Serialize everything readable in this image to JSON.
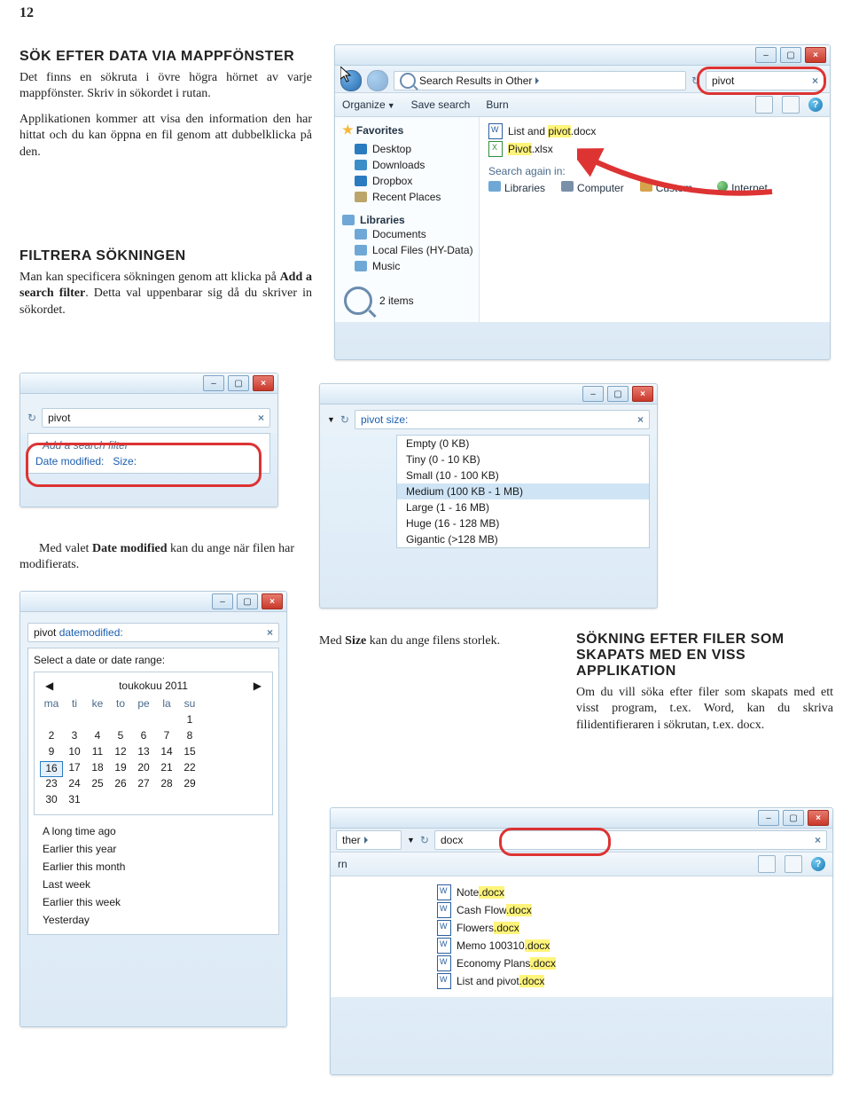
{
  "page_number": "12",
  "sec1": {
    "title": "SÖK EFTER DATA VIA MAPPFÖNSTER",
    "p1": "Det finns en sökruta i övre högra hörnet av varje mappfönster. Skriv in sökordet i rutan.",
    "p2": "Applikationen kommer att visa den information den har hittat och du kan öppna en fil genom att dubbelklicka på den."
  },
  "sec2": {
    "title": "FILTRERA SÖKNINGEN",
    "p1a": "Man kan specificera sökningen genom att klicka på ",
    "p1b": "Add a search filter",
    "p1c": ". Detta val uppenbarar sig då du skriver in sökordet."
  },
  "cap_date_a": "Med valet ",
  "cap_date_b": "Date modified",
  "cap_date_c": " kan du ange när filen har modifierats.",
  "cap_size_a": "Med ",
  "cap_size_b": "Size",
  "cap_size_c": " kan du ange filens storlek.",
  "sec3": {
    "title": "SÖKNING EFTER FILER SOM SKAPATS MED EN VISS APPLIKATION",
    "p1": "Om du vill söka efter filer som skapats med ett visst program, t.ex. Word, kan du skriva filidentifieraren i sökrutan, t.ex. docx."
  },
  "shot1": {
    "crumb": "Search Results in Other",
    "search_value": "pivot",
    "toolbar": {
      "organize": "Organize",
      "save": "Save search",
      "burn": "Burn"
    },
    "fav_header": "Favorites",
    "fav": [
      "Desktop",
      "Downloads",
      "Dropbox",
      "Recent Places"
    ],
    "lib_header": "Libraries",
    "libs": [
      "Documents",
      "Local Files (HY-Data)",
      "Music"
    ],
    "items_count": "2 items",
    "file1a": "List and ",
    "file1b": "pivot",
    "file1c": ".docx",
    "file2a": "",
    "file2b": "Pivot",
    "file2c": ".xlsx",
    "again": "Search again in:",
    "loc": [
      "Libraries",
      "Computer",
      "Custom...",
      "Internet"
    ]
  },
  "shot_filter": {
    "value": "pivot",
    "hint": "Add a search filter",
    "date": "Date modified:",
    "size": "Size:"
  },
  "shot_size": {
    "value": "pivot size:",
    "opts": [
      "Empty (0 KB)",
      "Tiny (0 - 10 KB)",
      "Small (10 - 100 KB)",
      "Medium (100 KB - 1 MB)",
      "Large (1 - 16 MB)",
      "Huge (16 - 128 MB)",
      "Gigantic (>128 MB)"
    ],
    "selected": 3
  },
  "shot_date": {
    "value": "pivot datemodified:",
    "sel_label": "Select a date or date range:",
    "month": "toukokuu 2011",
    "weekdays": [
      "ma",
      "ti",
      "ke",
      "to",
      "pe",
      "la",
      "su"
    ],
    "days": [
      [
        "",
        "",
        "",
        "",
        "",
        "",
        "1"
      ],
      [
        "2",
        "3",
        "4",
        "5",
        "6",
        "7",
        "8"
      ],
      [
        "9",
        "10",
        "11",
        "12",
        "13",
        "14",
        "15"
      ],
      [
        "16",
        "17",
        "18",
        "19",
        "20",
        "21",
        "22"
      ],
      [
        "23",
        "24",
        "25",
        "26",
        "27",
        "28",
        "29"
      ],
      [
        "30",
        "31",
        "",
        "",
        "",
        "",
        ""
      ]
    ],
    "sel_day": "16",
    "ranges": [
      "A long time ago",
      "Earlier this year",
      "Earlier this month",
      "Last week",
      "Earlier this week",
      "Yesterday"
    ]
  },
  "shot_docx": {
    "crumb_tail": "ther",
    "burn_tail": "rn",
    "value": "docx",
    "files": [
      "Note.docx",
      "Cash Flow.docx",
      "Flowers.docx",
      "Memo 100310.docx",
      "Economy Plans.docx",
      "List and pivot.docx"
    ]
  }
}
